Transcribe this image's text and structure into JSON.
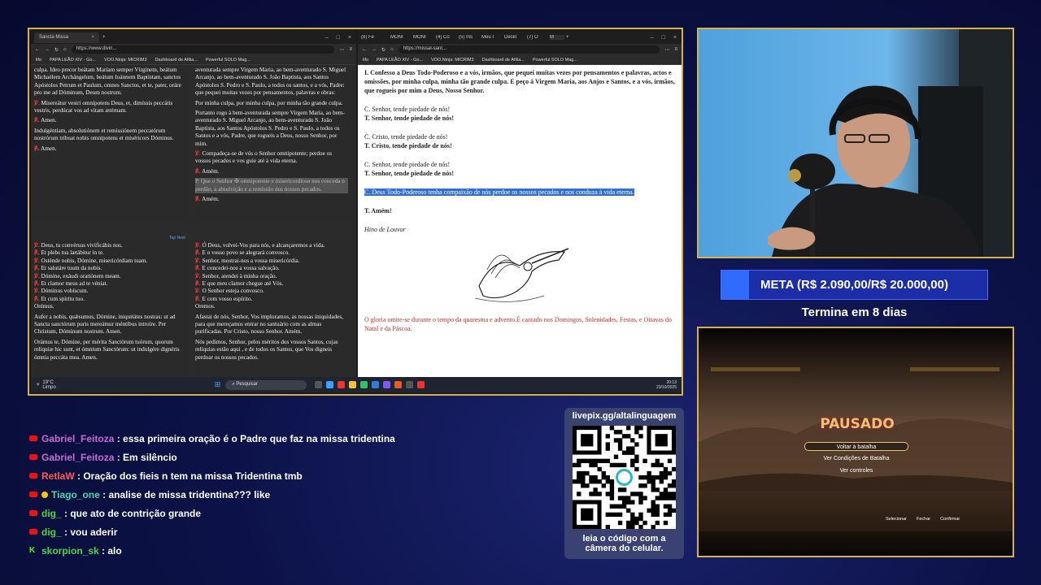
{
  "left_browser": {
    "tab_title": "Sancta Missa",
    "url": "https://www.divin...",
    "bookmarks": [
      "lifo",
      "PAPA LEÃO XIV - Go...",
      "VOO.Ninja: MICRIM3",
      "Dashboard de Afilia...",
      "Powerful SOLO Mag..."
    ],
    "latin_top": [
      "culpa. Ideo precor beátam Maríam semper Vírginem, beátum Michaélem Archángelum, beátum Ioánnem Baptístam, sanctos Apóstolos Petrum et Paulum, omnes Sanctos, et te, pater, oráre pro me ad Dóminum, Deum nostrum.",
      "Misereátur vestri omnípotens Deus, et, dimíssis peccátis vestris, perdúcat vos ad vitam ætérnam.",
      "Amen.",
      "Indulgéntiam, absolutiónem et remissiónem peccatórum nostrórum tríbuat nobis omnípotens et miséricors Dóminus.",
      "Amen."
    ],
    "pt_top": [
      "aventurada sempre Virgem Maria, ao bem-aventurado S. Miguel Arcanjo, ao bem-aventurado S. João Baptista, aos Santos Apóstolos S. Pedro e S. Paulo, a todos os santos, e a vós, Padre: que pequei muitas vezes por pensamentos, palavras e obras:",
      "Por minha culpa, por minha culpa, por minha tão grande culpa.",
      "Portanto rogo à bem-aventurada sempre Virgem Maria, ao bem-aventurado S. Miguel Arcanjo, ao bem-aventurado S. João Baptista, aos Santos Apóstolos S. Pedro e S. Paulo, a todos os Santos e a vós, Padre, que rogueis a Deus, nosso Senhor, por mim.",
      "Compadeça-se de vós o Senhor omnipotente; perdoe os vossos pecados e vos guie até à vida eterna.",
      "Amém."
    ],
    "pt_top_highlight": "P. Que o Senhor ✠ omnipotente e misericordioso nos conceda o perdão, a absolvição e a remissão dos nossos pecados.",
    "pt_top_end": "Amém.",
    "nav_links": [
      "Top",
      "Next"
    ],
    "latin_bottom": [
      "Deus, tu convérsus vivificábis nos.",
      "Et plebs tua lætábitur in te.",
      "Osténde nobis, Dómine, misericórdiam tuam.",
      "Et salutáre tuum da nobis.",
      "Dómine, exáudi oratiónem meam.",
      "Et clamor meus ad te véniat.",
      "Dóminus vobíscum.",
      "Et cum spíritu tuo.",
      "Orémus.",
      "Aufer a nobis, quǽsumus, Dómine, iniquitátes nostras: ut ad Sancta sanctórum puris mereámur méntibus introíre. Per Christum, Dóminum nostrum. Amen.",
      "Orámus te, Dómine, per mérita Sanctórum tuórum, quorum relíquiæ hic sunt, et ómnium Sanctórum: ut indulgére dignéris ómnia peccáta mea. Amen."
    ],
    "pt_bottom": [
      "Ó Deus, volvei-Vos para nós, e alcançaremos a vida.",
      "E o vosso povo se alegrará convosco.",
      "Senhor, mostrai-nos a vossa misericórdia.",
      "E concedei-nos a vossa salvação.",
      "Senhor, atendei à minha oração.",
      "E que meu clamor chegue até Vós.",
      "O Senhor esteja convosco.",
      "E com vosso espírito.",
      "Oremos.",
      "Afastai de nós, Senhor, Vos imploramos, as nossas iniquidades, para que mereçamos entrar no santuário com as almas purificadas. Por Cristo, nosso Senhor. Amém.",
      "Nós pedimos, Senhor, pelos méritos dos vossos Santos, cujas relíquias estão aqui , e de todos os Santos, que Vos digneis perdoar os nossos pecados."
    ]
  },
  "right_browser": {
    "tabs": [
      "(8) Fe",
      "MONI",
      "MONI",
      "(4) Co",
      "(5) Ins",
      "Meu I",
      "DeskI",
      "(7) O",
      "M"
    ],
    "url": "https://missal-sant...",
    "bookmarks": [
      "lifo",
      "PAPA LEÃO XIV - Go...",
      "VOO.Ninja: MICRIM3",
      "Dashboard de Afilia...",
      "Powerful SOLO Mag..."
    ],
    "confiteor": "I. Confesso a Deus Todo-Poderoso e a vós, irmãos, que pequei muitas vezes por pensamentos e palavras, actos e omissões, por minha culpa, minha tão grande culpa. E peço à Virgem Maria, aos Anjos e Santos, e a vós, irmãos, que rogueis por mim a Deus, Nosso Senhor.",
    "kyrie": [
      {
        "c": "C. Senhor, tende piedade de nós!",
        "t": "T. Senhor, tende piedade de nós!"
      },
      {
        "c": "C. Cristo, tende piedade de nós!",
        "t": "T. Cristo, tende piedade de nós!"
      },
      {
        "c": "C. Senhor, tende piedade de nós!",
        "t": "T. Senhor, tende piedade de nós!"
      }
    ],
    "selected": "C. Deus Todo-Poderoso tenha compaixão de nós perdoe os nossos pecados e nos conduza à vida eterna.",
    "amen": "T. Amém!",
    "hymn": "Hino de Louvor",
    "note": "O gloria omite-se durante o tempo da quaresma e advento.É cantado nos Domingos, Solenidades, Festas, e Oitavas do Natal e da Páscoa."
  },
  "taskbar": {
    "weather_temp": "19°C",
    "weather_desc": "Limpo",
    "search": "Pesquisar",
    "time": "20:13",
    "date": "23/10/2025"
  },
  "goal": {
    "label": "META (R$ 2.090,00/R$ 20.000,00)",
    "progress": 0.1045,
    "remaining": "Termina em 8 dias"
  },
  "chat": [
    {
      "platform": "youtube",
      "user": "Gabriel_Feitoza",
      "color": "#c86bd6",
      "text": ": essa primeira oração é o Padre que faz na missa tridentina"
    },
    {
      "platform": "youtube",
      "user": "Gabriel_Feitoza",
      "color": "#c86bd6",
      "text": ": Em silêncio"
    },
    {
      "platform": "youtube",
      "user": "RetlaW",
      "color": "#ff5a5a",
      "text": ": Oração dos fieis n tem na missa Tridentina tmb"
    },
    {
      "platform": "youtube-mod",
      "user": "Tiago_one",
      "color": "#4dd6b0",
      "text": ": analise de missa tridentina??? like"
    },
    {
      "platform": "youtube",
      "user": "dig_",
      "color": "#4cd44c",
      "text": ": que ato de contrição grande"
    },
    {
      "platform": "youtube",
      "user": "dig_",
      "color": "#4cd44c",
      "text": ": vou aderir"
    },
    {
      "platform": "kick",
      "user": "skorpion_sk",
      "color": "#4cd44c",
      "text": ": alo"
    }
  ],
  "qr": {
    "title": "livepix.gg/altalinguagem",
    "caption_line1": "leia o código com a",
    "caption_line2": "câmera do celular."
  },
  "game": {
    "title": "PAUSADO",
    "menu": [
      "Voltar à batalha",
      "Ver Condições de Batalha",
      "Ver controles"
    ],
    "footer": [
      "Selecionar",
      "Fechar",
      "Confirmar"
    ]
  }
}
